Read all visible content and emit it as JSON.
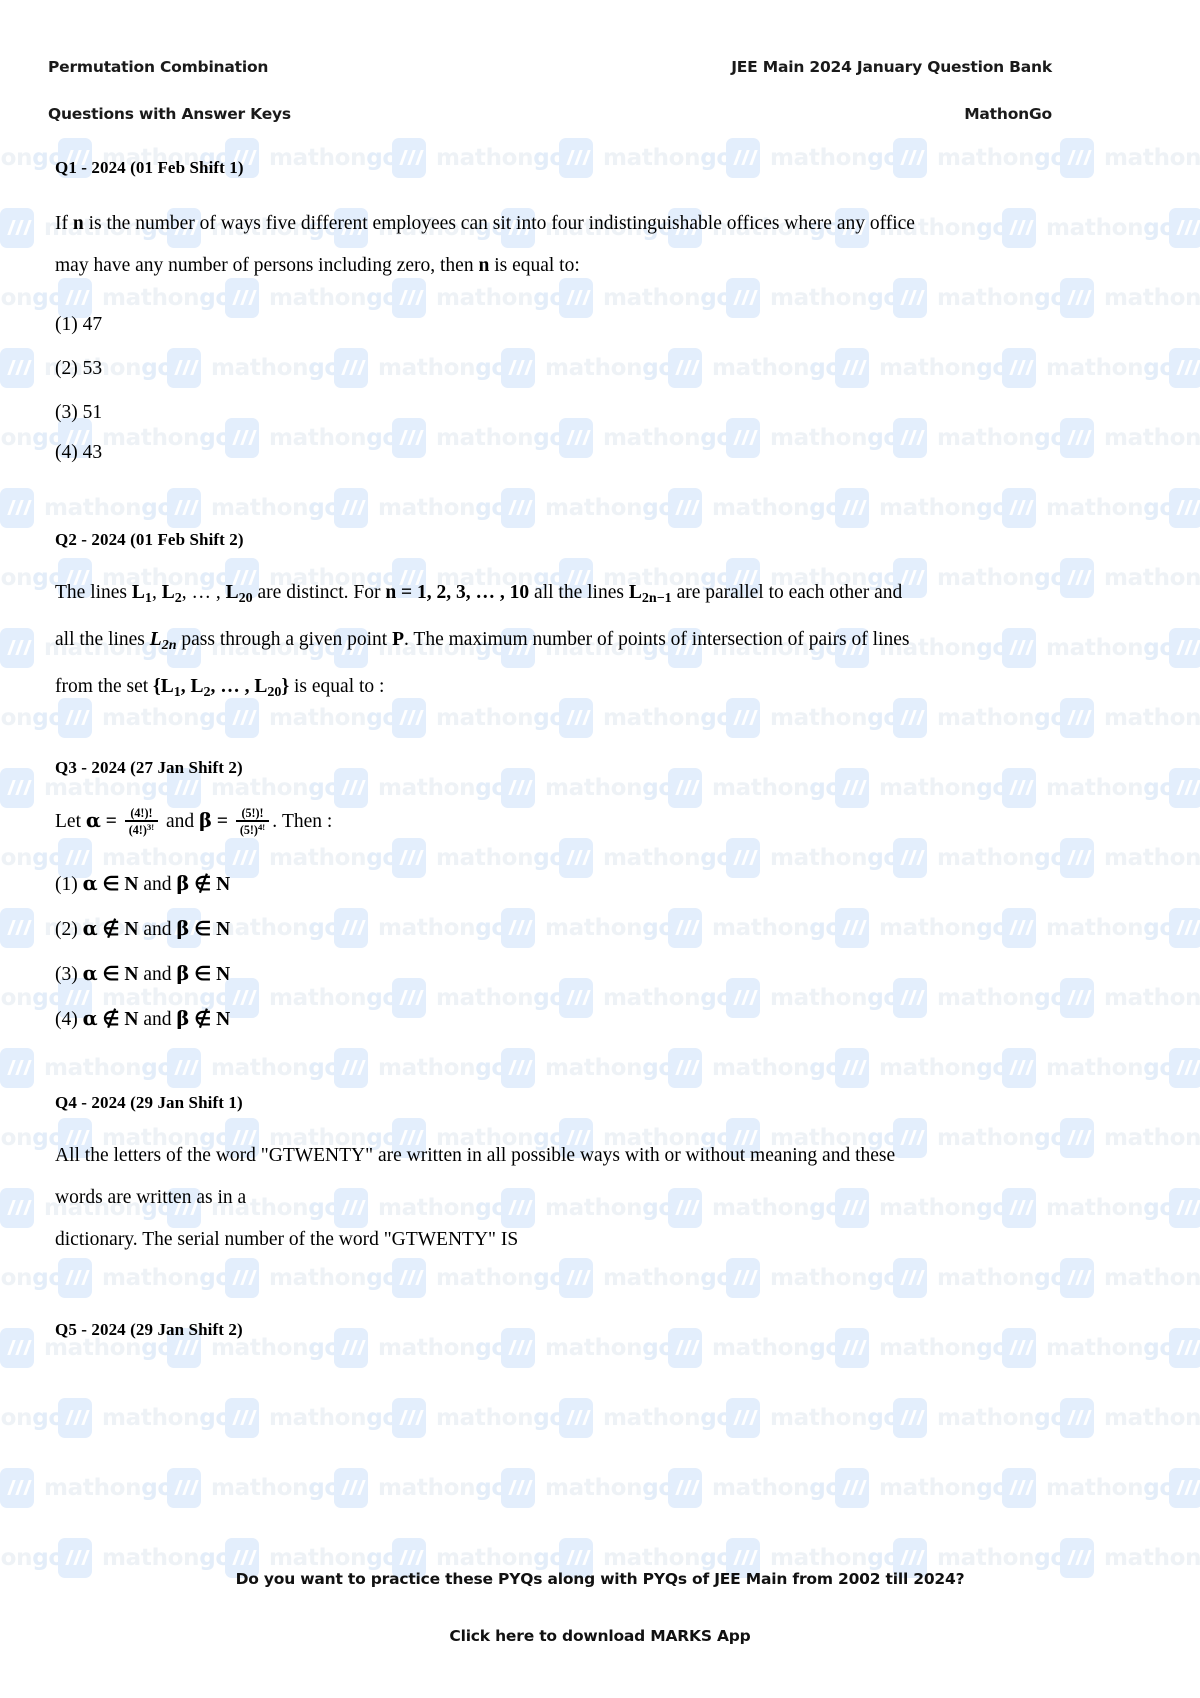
{
  "header": {
    "left_title": "Permutation Combination",
    "right_title": "JEE Main 2024 January Question Bank",
    "left_subtitle": "Questions with Answer Keys",
    "brand": "MathonGo"
  },
  "watermark": {
    "text_main": "mathon",
    "text_accent": "go",
    "icon": "mathongo-logo-icon"
  },
  "questions": [
    {
      "label": "Q1 - 2024 (01 Feb Shift 1)",
      "body_line_1_a": "If ",
      "body_var_n": "n",
      "body_line_1_b": " is the number of ways five different employees can sit into four indistinguishable offices where any office",
      "body_line_2_a": "may have any number of persons including zero, then ",
      "body_line_2_b": " is equal to:",
      "options": [
        "(1) 47",
        "(2) 53",
        "(3) 51",
        "(4) 43"
      ]
    },
    {
      "label": "Q2 - 2024 (01 Feb Shift 2)",
      "line1_t1": "The lines ",
      "line1_L1": "L",
      "line1_L1sub": "1",
      "line1_t2": ",  ",
      "line1_L2": "L",
      "line1_L2sub": "2",
      "line1_t3": ", … , ",
      "line1_L20": "L",
      "line1_L20sub": "20",
      "line1_t4": " are distinct. For ",
      "line1_n_eq": "n = 1, 2, 3, … , 10",
      "line1_t5": " all the lines ",
      "line1_L2n1": "L",
      "line1_L2n1sub": "2n−1",
      "line1_t6": " are parallel to each other and",
      "line2_t1": "all the lines ",
      "line2_L2n": "L",
      "line2_L2nsub": "2n",
      "line2_t2": " pass through a given point ",
      "line2_P": "P",
      "line2_t3": ". The maximum number of points of intersection of pairs of lines",
      "line3_t1": "from the set ",
      "line3_set_open": "{L",
      "line3_set_s1": "1",
      "line3_set_mid": ", L",
      "line3_set_s2": "2",
      "line3_set_dots": ", … , L",
      "line3_set_s3": "20",
      "line3_set_close": "}",
      "line3_t2": " is equal to :"
    },
    {
      "label": "Q3 - 2024 (27 Jan Shift 2)",
      "stem_t1": "Let ",
      "stem_alpha": "α",
      "stem_eq1": " = ",
      "alpha_num": "(4!)!",
      "alpha_den_base": "(4!)",
      "alpha_den_exp": "3!",
      "stem_t2": " and ",
      "stem_beta": "β",
      "stem_eq2": " = ",
      "beta_num": "(5!)!",
      "beta_den_base": "(5!)",
      "beta_den_exp": "4!",
      "stem_t3": ". Then :",
      "options": [
        {
          "num": "(1) ",
          "a": "α",
          "rel1": " ∈ ",
          "n1": "N",
          "and": " and ",
          "b": "β",
          "rel2": " ∉ ",
          "n2": "N"
        },
        {
          "num": "(2) ",
          "a": "α",
          "rel1": " ∉ ",
          "n1": "N",
          "and": " and ",
          "b": "β",
          "rel2": " ∈ ",
          "n2": "N"
        },
        {
          "num": "(3) ",
          "a": "α",
          "rel1": " ∈ ",
          "n1": "N",
          "and": " and ",
          "b": "β",
          "rel2": " ∈ ",
          "n2": "N"
        },
        {
          "num": "(4) ",
          "a": "α",
          "rel1": " ∉ ",
          "n1": "N",
          "and": " and ",
          "b": "β",
          "rel2": " ∉ ",
          "n2": "N"
        }
      ]
    },
    {
      "label": "Q4 - 2024 (29 Jan Shift 1)",
      "body_line_1": "All the letters of the word \"GTWENTY\" are written in all possible ways with or without meaning and these",
      "body_line_2": "words are written as in a",
      "body_line_3": "dictionary. The serial number of the word \"GTWENTY\" IS"
    },
    {
      "label": "Q5 - 2024 (29 Jan Shift 2)"
    }
  ],
  "footer": {
    "line1": "Do you want to practice these PYQs along with PYQs of JEE Main from 2002 till 2024?",
    "line2": "Click here to download MARKS App"
  }
}
